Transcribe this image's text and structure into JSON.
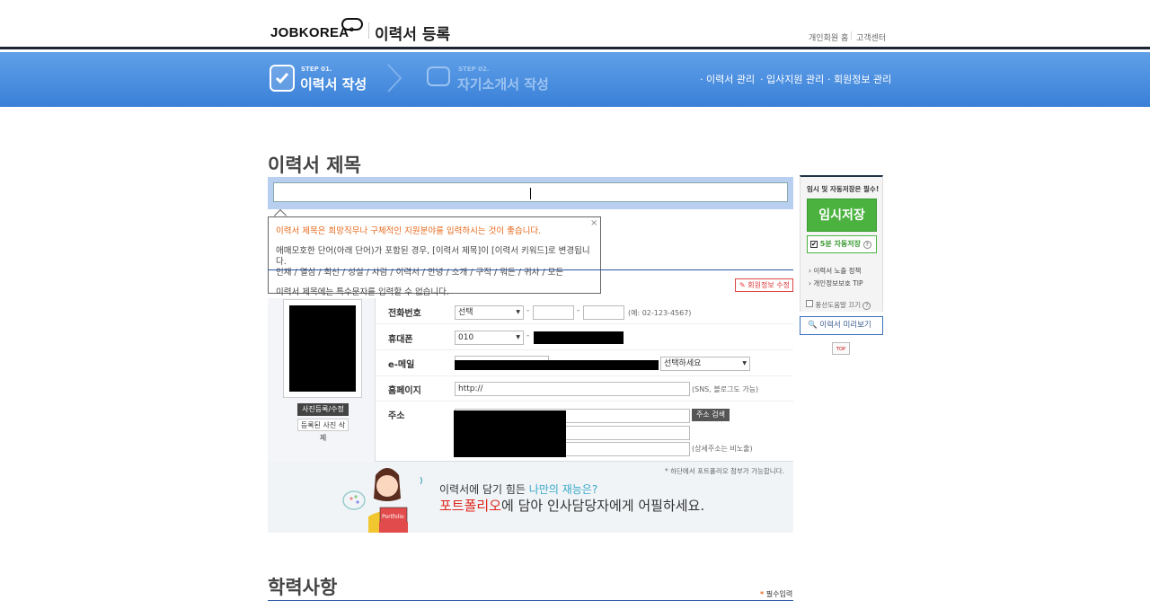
{
  "header": {
    "logo": "JOBKOREA°",
    "title": "이력서 등록",
    "links": [
      "개인회원 홈",
      "고객센터"
    ]
  },
  "steps": [
    {
      "small": "STEP 01.",
      "label": "이력서 작성",
      "active": true
    },
    {
      "small": "STEP 02.",
      "label": "자기소개서 작성",
      "active": false
    }
  ],
  "nav": [
    "· 이력서 관리",
    "· 입사지원 관리",
    "· 회원정보 관리"
  ],
  "resume_title": {
    "heading": "이력서 제목",
    "value": ""
  },
  "tooltip": {
    "line1": "이력서 제목은 희망직무나 구체적인 지원분야를 입력하시는 것이 좋습니다.",
    "line2": "애매모호한 단어(아래 단어)가 포함된 경우, [이력서 제목]이 [이력서 키워드]로 변경됩니다.",
    "line3": "인재 / 열심 / 최선 / 성실 / 사람 / 이력서 / 안녕 / 소개 / 구직 / 뭐든 / 귀사 / 모든",
    "line4": "이력서 제목에는 특수문자를 입력할 수 없습니다.",
    "close": "×"
  },
  "sidebar": {
    "notice": "임시 및 자동저장은 필수!",
    "save_button": "임시저장",
    "auto_save": "5분 자동저장",
    "links": [
      "이력서 노출 정책",
      "개인정보보호 TIP"
    ],
    "balloon": "풍선도움말 끄기",
    "preview": "이력서 미리보기",
    "top": "TOP"
  },
  "edit_member": "회원정보 수정",
  "photo": {
    "edit": "사진등록/수정",
    "delete": "등록된 사진 삭제"
  },
  "form": {
    "phone": {
      "label": "전화번호",
      "select": "선택",
      "hint": "(예: 02-123-4567)"
    },
    "mobile": {
      "label": "휴대폰",
      "select": "010"
    },
    "email": {
      "label": "e-메일",
      "select": "선택하세요"
    },
    "homepage": {
      "label": "홈페이지",
      "value": "http://",
      "hint": "(SNS, 블로그도 가능)"
    },
    "address": {
      "label": "주소",
      "button": "주소 검색",
      "hint": "(상세주소는 비노출)"
    }
  },
  "portfolio": {
    "note": "* 하단에서 포트폴리오 첨부가 가능합니다.",
    "line1_a": "이력서에 담기 힘든 ",
    "line1_b": "나만의 재능은?",
    "line2_a": "포트폴리오",
    "line2_b": "에 담아 인사담당자에게 어필하세요.",
    "tag": "Portfolio"
  },
  "education": {
    "heading": "학력사항",
    "required": "필수입력"
  },
  "colors": {
    "nav_bar": "#4a8fe0",
    "save_green": "#4bb240",
    "accent_orange": "#e8681a"
  }
}
